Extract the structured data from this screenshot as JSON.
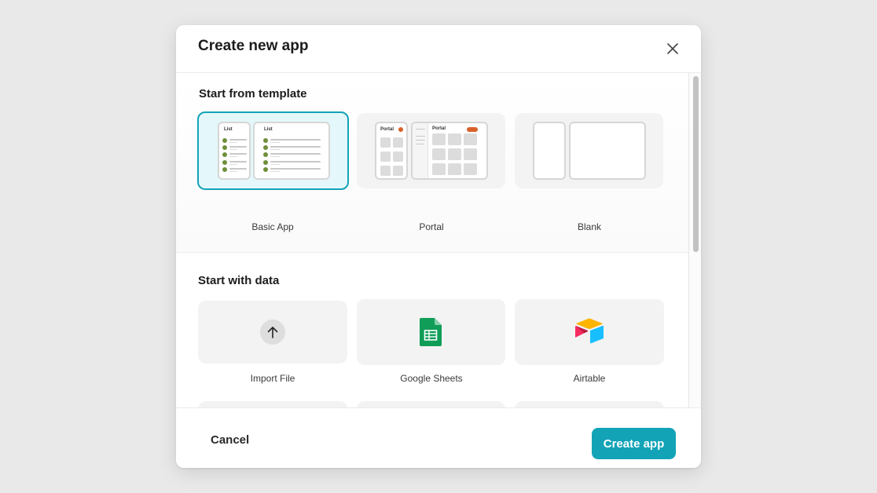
{
  "modal": {
    "title": "Create new app",
    "close_icon": "close-icon"
  },
  "templates": {
    "section_title": "Start from template",
    "items": [
      {
        "label": "Basic App",
        "selected": true,
        "mock_title": "List"
      },
      {
        "label": "Portal",
        "selected": false,
        "mock_title": "Portal"
      },
      {
        "label": "Blank",
        "selected": false
      }
    ]
  },
  "data_sources": {
    "section_title": "Start with data",
    "items": [
      {
        "label": "Import File",
        "icon": "upload-icon"
      },
      {
        "label": "Google Sheets",
        "icon": "google-sheets-icon"
      },
      {
        "label": "Airtable",
        "icon": "airtable-icon"
      },
      {
        "label": "",
        "icon": "excel-icon"
      },
      {
        "label": "",
        "icon": "database-icon"
      },
      {
        "label": "",
        "icon": "postgresql-icon"
      }
    ]
  },
  "footer": {
    "cancel_label": "Cancel",
    "create_label": "Create app"
  },
  "colors": {
    "accent": "#13a3b7",
    "selected_bg": "#e4f7fa",
    "list_dot": "#6e8f3a",
    "portal_badge": "#d9602a"
  }
}
